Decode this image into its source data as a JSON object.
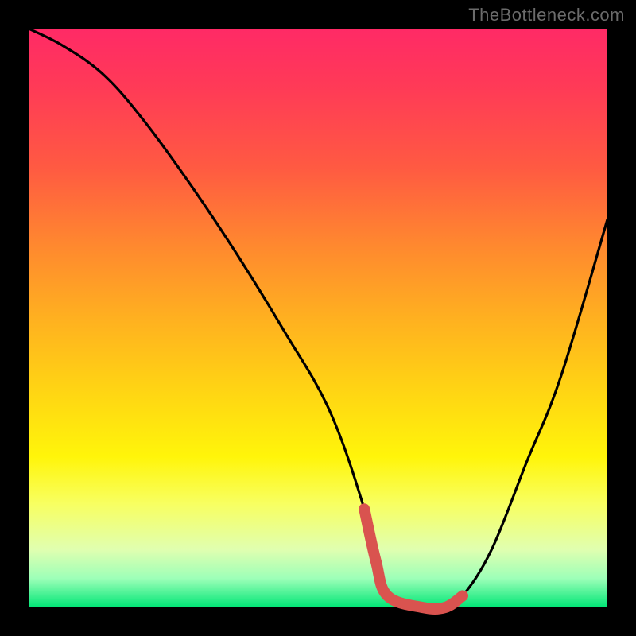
{
  "watermark": "TheBottleneck.com",
  "colors": {
    "background_frame": "#000000",
    "curve_stroke": "#000000",
    "marker_stroke": "#d9534f",
    "gradient_top": "#ff2a66",
    "gradient_mid": "#ffd314",
    "gradient_bottom": "#00e676"
  },
  "chart_data": {
    "type": "line",
    "title": "",
    "xlabel": "",
    "ylabel": "",
    "xlim": [
      0,
      100
    ],
    "ylim": [
      0,
      100
    ],
    "grid": false,
    "series": [
      {
        "name": "bottleneck-curve",
        "x": [
          0,
          6,
          13,
          20,
          28,
          36,
          44,
          52,
          58,
          60,
          62,
          68,
          72,
          75,
          80,
          86,
          92,
          100
        ],
        "values": [
          100,
          97,
          92,
          84,
          73,
          61,
          48,
          34,
          17,
          8,
          2,
          0,
          0,
          2,
          10,
          25,
          40,
          67
        ]
      }
    ],
    "marker_segment": {
      "name": "optimal-range",
      "x": [
        58,
        60,
        62,
        68,
        72,
        75
      ],
      "values": [
        17,
        8,
        2,
        0,
        0,
        2
      ]
    },
    "legend": null
  }
}
